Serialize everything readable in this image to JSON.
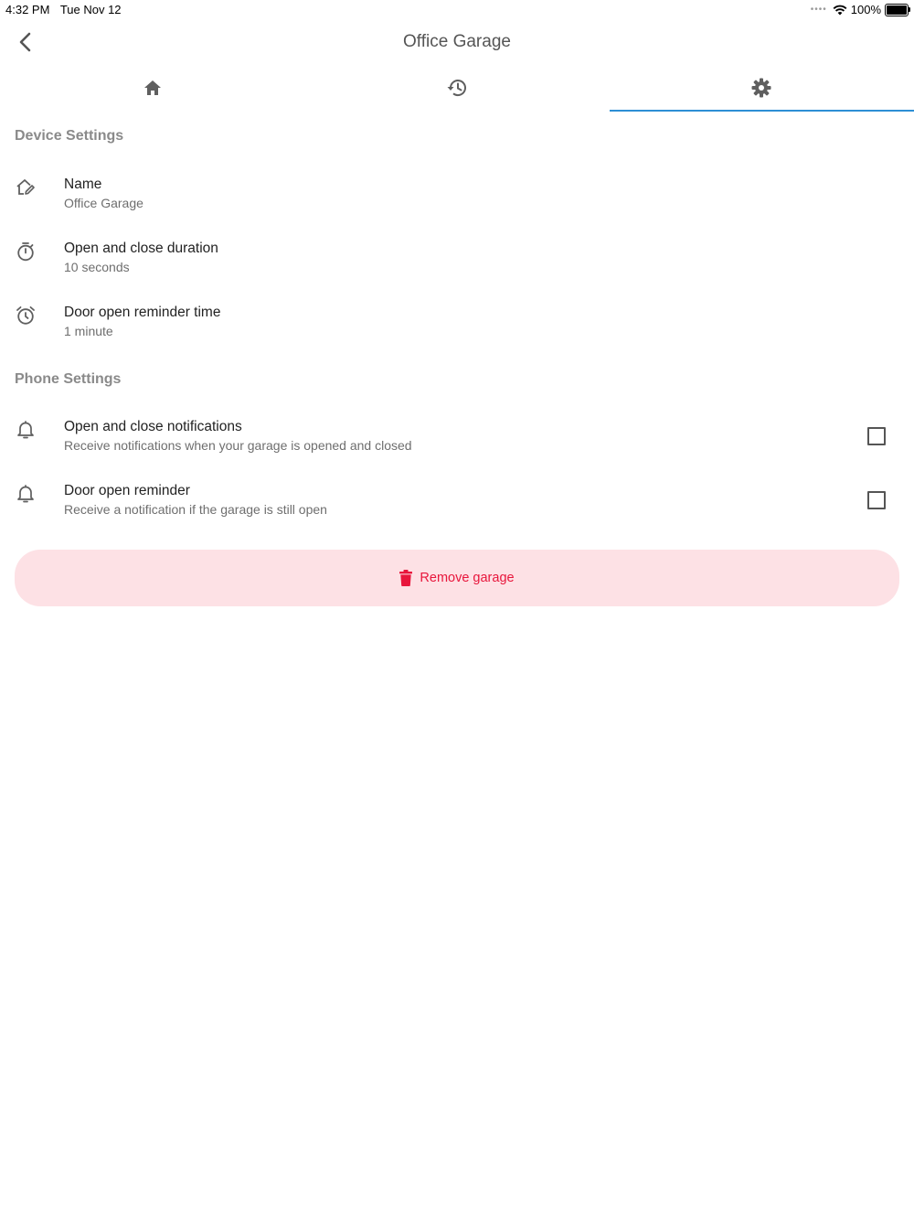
{
  "status_bar": {
    "time": "4:32 PM",
    "date": "Tue Nov 12",
    "battery_pct_label": "100%",
    "battery_level": 1.0
  },
  "app_bar": {
    "title": "Office Garage",
    "back_icon": "chevron-left-icon"
  },
  "tabs": [
    {
      "id": "home",
      "icon": "home-icon",
      "active": false
    },
    {
      "id": "history",
      "icon": "history-icon",
      "active": false
    },
    {
      "id": "settings",
      "icon": "gear-icon",
      "active": true
    }
  ],
  "device_settings": {
    "header": "Device Settings",
    "items": [
      {
        "title": "Name",
        "subtitle": "Office Garage",
        "icon": "home-edit-icon"
      },
      {
        "title": "Open and close duration",
        "subtitle": "10 seconds",
        "icon": "timer-icon"
      },
      {
        "title": "Door open reminder time",
        "subtitle": "1 minute",
        "icon": "alarm-clock-icon"
      }
    ]
  },
  "phone_settings": {
    "header": "Phone Settings",
    "items": [
      {
        "title": "Open and close notifications",
        "subtitle": "Receive notifications when your garage is opened and closed",
        "icon": "bell-icon",
        "checked": false
      },
      {
        "title": "Door open reminder",
        "subtitle": "Receive a notification if the garage is still open",
        "icon": "bell-icon",
        "checked": false
      }
    ]
  },
  "remove_button": {
    "label": "Remove garage",
    "icon": "trash-icon"
  },
  "colors": {
    "accent": "#2d8fd5",
    "danger": "#e8163c",
    "danger_bg": "#fde1e5"
  }
}
